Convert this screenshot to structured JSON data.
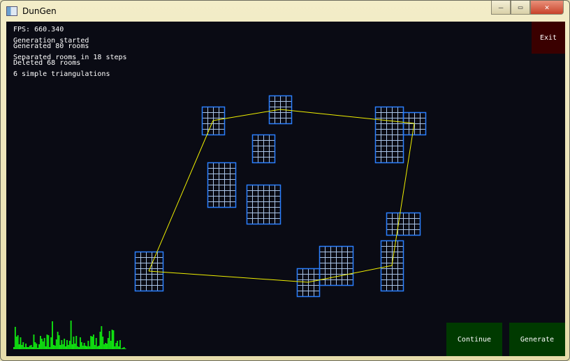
{
  "window": {
    "title": "DunGen",
    "minimize": "—",
    "maximize": "▭",
    "close": "✕"
  },
  "log": {
    "fps": "FPS: 660.340",
    "lines1": [
      "Generation started",
      "Generated 80 rooms"
    ],
    "lines2": [
      "Separated rooms in 18 steps",
      "Deleted 68 rooms"
    ],
    "lines3": [
      "6 simple triangulations"
    ]
  },
  "buttons": {
    "exit": "Exit",
    "continue": "Continue",
    "generate": "Generate"
  },
  "colors": {
    "room_border": "#2a7fff",
    "room_grid": "#a9c3e6",
    "edge": "#f0f000",
    "graph_bar": "#10e010",
    "exit_bg": "#3a0000",
    "continue_bg": "#003a00",
    "generate_bg": "#003a00"
  },
  "rooms": [
    {
      "col": 36,
      "row": 19,
      "w": 4,
      "h": 5
    },
    {
      "col": 48,
      "row": 17,
      "w": 4,
      "h": 5
    },
    {
      "col": 67,
      "row": 19,
      "w": 5,
      "h": 10
    },
    {
      "col": 72,
      "row": 20,
      "w": 4,
      "h": 4
    },
    {
      "col": 45,
      "row": 24,
      "w": 4,
      "h": 5
    },
    {
      "col": 37,
      "row": 29,
      "w": 5,
      "h": 8
    },
    {
      "col": 44,
      "row": 33,
      "w": 6,
      "h": 7
    },
    {
      "col": 69,
      "row": 38,
      "w": 6,
      "h": 4
    },
    {
      "col": 68,
      "row": 43,
      "w": 4,
      "h": 9
    },
    {
      "col": 57,
      "row": 44,
      "w": 6,
      "h": 7
    },
    {
      "col": 53,
      "row": 48,
      "w": 4,
      "h": 5
    },
    {
      "col": 24,
      "row": 45,
      "w": 5,
      "h": 7
    }
  ],
  "edges": [
    [
      11,
      0
    ],
    [
      0,
      1
    ],
    [
      1,
      3
    ],
    [
      3,
      8
    ],
    [
      8,
      10
    ],
    [
      10,
      11
    ]
  ],
  "frame_graph": [
    3,
    32,
    18,
    20,
    7,
    17,
    6,
    10,
    3,
    8,
    3,
    3,
    5,
    6,
    3,
    21,
    10,
    8,
    2,
    7,
    19,
    15,
    11,
    16,
    4,
    21,
    20,
    3,
    17,
    40,
    6,
    5,
    14,
    25,
    20,
    6,
    13,
    7,
    15,
    4,
    13,
    6,
    12,
    41,
    7,
    18,
    8,
    19,
    4,
    3,
    17,
    10,
    5,
    9,
    5,
    4,
    12,
    4,
    19,
    18,
    21,
    6,
    16,
    4,
    5,
    25,
    33,
    18,
    7,
    9,
    8,
    16,
    26,
    12,
    28,
    27,
    4,
    9,
    12,
    4,
    13,
    1,
    2,
    3,
    1
  ]
}
